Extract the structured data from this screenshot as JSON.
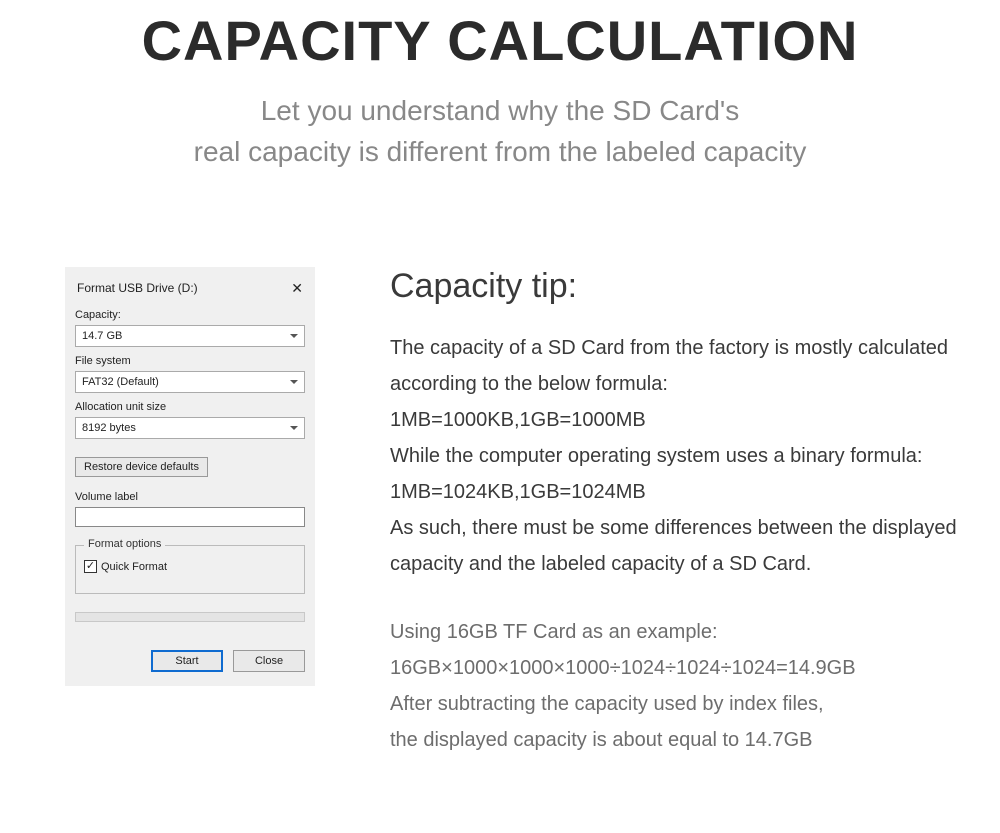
{
  "header": {
    "title": "CAPACITY CALCULATION",
    "subtitle_line1": "Let you understand why the SD Card's",
    "subtitle_line2": "real capacity is different from the labeled capacity"
  },
  "dialog": {
    "title": "Format USB Drive (D:)",
    "close_glyph": "✕",
    "capacity_label": "Capacity:",
    "capacity_value": "14.7 GB",
    "filesystem_label": "File system",
    "filesystem_value": "FAT32 (Default)",
    "allocation_label": "Allocation unit size",
    "allocation_value": "8192 bytes",
    "restore_defaults_label": "Restore device defaults",
    "volume_label_label": "Volume label",
    "volume_label_value": "",
    "options_legend": "Format options",
    "quick_format_label": "Quick Format",
    "quick_format_checked": true,
    "check_glyph": "✓",
    "start_label": "Start",
    "close_label": "Close"
  },
  "tip": {
    "heading": "Capacity tip:",
    "p1": "The capacity of a SD Card from the factory is mostly calculated according to the below formula:",
    "p2": "1MB=1000KB,1GB=1000MB",
    "p3": "While the computer operating system uses a binary formula:",
    "p4": "1MB=1024KB,1GB=1024MB",
    "p5": "As such, there must be some differences between the displayed capacity and the labeled capacity of a SD Card.",
    "ex1": "Using 16GB TF Card as an example:",
    "ex2": "16GB×1000×1000×1000÷1024÷1024÷1024=14.9GB",
    "ex3": "After subtracting the capacity used by index files,",
    "ex4": "the displayed capacity is about equal to 14.7GB"
  }
}
